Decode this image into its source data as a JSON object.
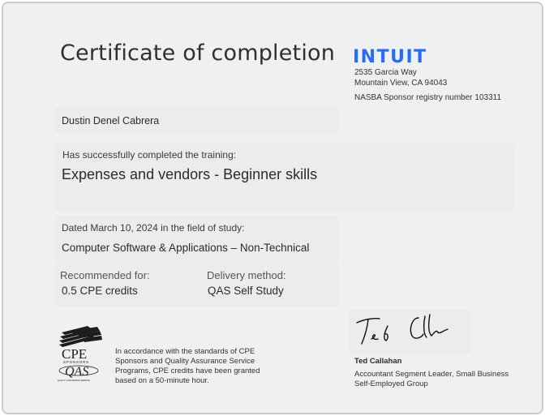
{
  "certificate": {
    "title": "Certificate of completion",
    "issuer": {
      "logo_text": "INTUIT",
      "address_line1": "2535 Garcia Way",
      "address_line2": "Mountain View, CA 94043",
      "nasba": "NASBA Sponsor registry number 103311",
      "brand_color": "#236CFF"
    },
    "recipient": "Dustin Denel Cabrera",
    "completed_label": "Has successfully completed the training:",
    "course": "Expenses and vendors - Beginner skills",
    "dated": "Dated March 10, 2024 in the field of study:",
    "field_of_study": "Computer Software & Applications – Non-Technical",
    "recommended_label": "Recommended for:",
    "recommended_value": "0.5 CPE credits",
    "delivery_label": "Delivery method:",
    "delivery_value": "QAS Self Study",
    "sponsor_logo_top": "CPE",
    "sponsor_logo_mid": "SPONSORS",
    "sponsor_logo_bottom": "QAS",
    "sponsor_logo_tag": "QUALITY ASSURANCE SERVICE",
    "standards_text": "In accordance with the standards of CPE Sponsors and Quality Assurance Service Programs, CPE credits have been granted based on a 50-minute hour.",
    "signer_name": "Ted Callahan",
    "signer_title": "Accountant Segment Leader, Small Business Self-Employed Group"
  }
}
